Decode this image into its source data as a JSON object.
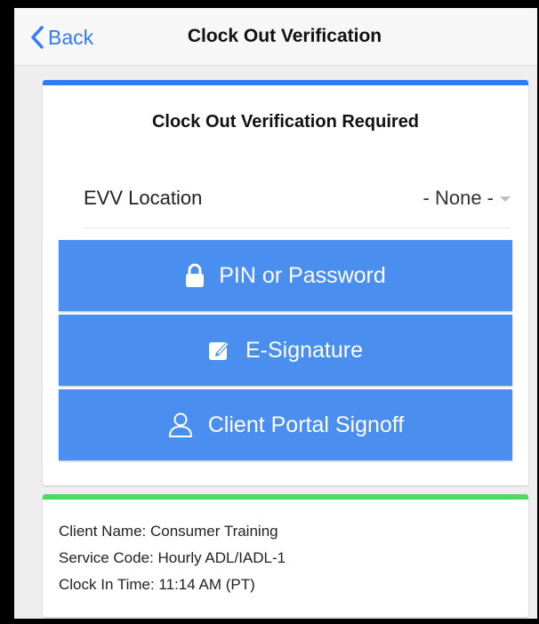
{
  "navbar": {
    "back_label": "Back",
    "title": "Clock Out Verification"
  },
  "card": {
    "heading": "Clock Out Verification Required",
    "evv_label": "EVV Location",
    "evv_value": "- None -",
    "buttons": [
      {
        "label": "PIN or Password",
        "icon": "lock-icon"
      },
      {
        "label": "E-Signature",
        "icon": "edit-signature-icon"
      },
      {
        "label": "Client Portal Signoff",
        "icon": "user-icon"
      }
    ]
  },
  "info": {
    "client_name": "Client Name: Consumer Training",
    "service_code": "Service Code: Hourly ADL/IADL-1",
    "clock_in_time": "Clock In Time: 11:14 AM (PT)"
  },
  "colors": {
    "accent": "#2f7cf6",
    "button": "#4a8ef0",
    "success": "#4cd964"
  }
}
